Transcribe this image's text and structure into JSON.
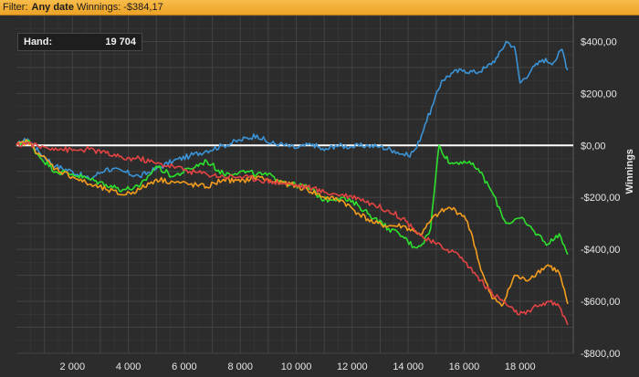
{
  "filter_bar": {
    "filter_label": "Filter:",
    "filter_value": "Any date",
    "winnings_label": "Winnings:",
    "winnings_value": "-$384,17"
  },
  "info_box": {
    "label": "Hand:",
    "value": "19 704"
  },
  "colors": {
    "background": "#2c2c2c",
    "grid": "#454545",
    "zero_line": "#ffffff",
    "blue": "#3b93d6",
    "green": "#2ee02e",
    "orange": "#f39c1d",
    "red": "#e24343",
    "filter_bar": "#f2ad33"
  },
  "chart_data": {
    "type": "line",
    "title": "",
    "xlabel": "",
    "ylabel": "Winnings",
    "xlim": [
      0,
      19900
    ],
    "ylim": [
      -800,
      500
    ],
    "grid": true,
    "legend": "none",
    "x_ticks": [
      2000,
      4000,
      6000,
      8000,
      10000,
      12000,
      14000,
      16000,
      18000
    ],
    "x_tick_labels": [
      "2 000",
      "4 000",
      "6 000",
      "8 000",
      "10 000",
      "12 000",
      "14 000",
      "16 000",
      "18 000"
    ],
    "y_ticks": [
      400,
      200,
      0,
      -200,
      -400,
      -600,
      -800
    ],
    "y_tick_labels": [
      "$400,00",
      "$200,00",
      "$0,00",
      "-$200,00",
      "-$400,00",
      "-$600,00",
      "-$800,00"
    ],
    "series": [
      {
        "color": "#3b93d6",
        "x": [
          0,
          400,
          800,
          1400,
          2000,
          2600,
          3200,
          3800,
          4400,
          5000,
          5600,
          6200,
          6800,
          7400,
          8000,
          8600,
          9000,
          9400,
          10000,
          10600,
          11000,
          11400,
          12000,
          12500,
          13000,
          13500,
          14000,
          14300,
          14600,
          14900,
          15200,
          15600,
          16000,
          16400,
          16800,
          17200,
          17500,
          17800,
          18000,
          18400,
          18800,
          19200,
          19500,
          19700
        ],
        "y": [
          0,
          25,
          -25,
          -80,
          -100,
          -130,
          -90,
          -100,
          -120,
          -90,
          -60,
          -40,
          -20,
          0,
          20,
          40,
          10,
          5,
          -10,
          5,
          -20,
          0,
          -5,
          0,
          -5,
          -20,
          -40,
          -10,
          80,
          160,
          250,
          280,
          290,
          280,
          300,
          340,
          400,
          380,
          240,
          290,
          330,
          320,
          370,
          290
        ]
      },
      {
        "color": "#2ee02e",
        "x": [
          0,
          400,
          800,
          1400,
          2000,
          2600,
          3200,
          3800,
          4400,
          5000,
          5600,
          6200,
          6800,
          7400,
          8000,
          8600,
          9200,
          9800,
          10400,
          11000,
          11600,
          12200,
          12800,
          13300,
          13800,
          14200,
          14500,
          14800,
          15100,
          15500,
          16000,
          16500,
          17000,
          17500,
          18000,
          18500,
          19000,
          19400,
          19700
        ],
        "y": [
          0,
          20,
          -40,
          -100,
          -110,
          -130,
          -150,
          -170,
          -160,
          -80,
          -120,
          -90,
          -60,
          -110,
          -100,
          -110,
          -120,
          -150,
          -160,
          -210,
          -200,
          -230,
          -280,
          -320,
          -350,
          -390,
          -380,
          -320,
          0,
          -70,
          -60,
          -90,
          -180,
          -300,
          -280,
          -330,
          -380,
          -340,
          -420
        ]
      },
      {
        "color": "#f39c1d",
        "x": [
          0,
          400,
          800,
          1400,
          2000,
          2600,
          3200,
          3800,
          4400,
          5000,
          5600,
          6200,
          6800,
          7400,
          8000,
          8600,
          9200,
          9800,
          10400,
          11000,
          11600,
          12200,
          12800,
          13300,
          13800,
          14200,
          14500,
          14800,
          15100,
          15500,
          16000,
          16300,
          16600,
          17000,
          17400,
          17800,
          18200,
          18600,
          19000,
          19400,
          19700
        ],
        "y": [
          0,
          15,
          -30,
          -90,
          -120,
          -150,
          -170,
          -190,
          -170,
          -130,
          -140,
          -150,
          -160,
          -130,
          -140,
          -120,
          -140,
          -150,
          -170,
          -200,
          -210,
          -260,
          -300,
          -310,
          -310,
          -330,
          -340,
          -290,
          -260,
          -240,
          -270,
          -350,
          -480,
          -590,
          -610,
          -500,
          -520,
          -490,
          -460,
          -490,
          -610
        ]
      },
      {
        "color": "#e24343",
        "x": [
          0,
          400,
          800,
          1400,
          2000,
          2600,
          3200,
          3800,
          4400,
          5000,
          5600,
          6200,
          6800,
          7400,
          8000,
          8600,
          9200,
          9800,
          10400,
          11000,
          11600,
          12200,
          12800,
          13300,
          13800,
          14200,
          14600,
          15000,
          15400,
          15800,
          16200,
          16600,
          17000,
          17400,
          17800,
          18200,
          18600,
          19000,
          19400,
          19700
        ],
        "y": [
          0,
          10,
          -5,
          -10,
          -20,
          -15,
          -30,
          -50,
          -50,
          -70,
          -80,
          -100,
          -110,
          -120,
          -120,
          -130,
          -140,
          -150,
          -160,
          -180,
          -190,
          -200,
          -230,
          -250,
          -280,
          -320,
          -360,
          -380,
          -400,
          -420,
          -470,
          -520,
          -570,
          -600,
          -640,
          -650,
          -620,
          -600,
          -620,
          -690
        ]
      }
    ]
  }
}
